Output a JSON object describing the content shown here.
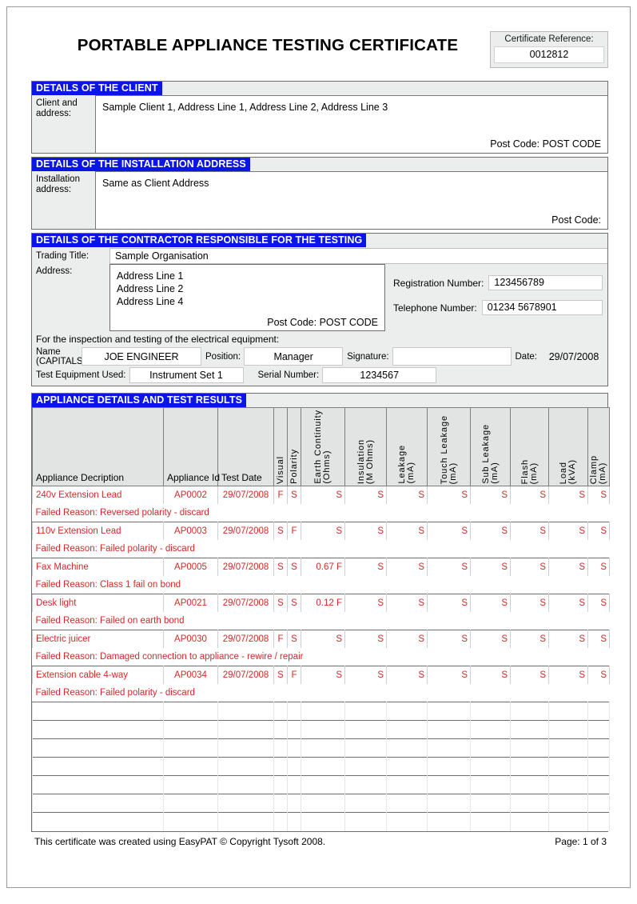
{
  "document": {
    "title": "PORTABLE APPLIANCE TESTING CERTIFICATE",
    "certificate_reference_label": "Certificate Reference:",
    "certificate_reference_value": "0012812"
  },
  "client": {
    "section_title": "DETAILS OF THE CLIENT",
    "label": "Client and address:",
    "label_line1": "Client and",
    "label_line2": "address:",
    "address": "Sample Client 1, Address Line 1, Address Line 2, Address Line 3",
    "postcode_label": "Post Code:",
    "postcode_value": "POST CODE"
  },
  "installation": {
    "section_title": "DETAILS OF THE INSTALLATION ADDRESS",
    "label_line1": "Installation",
    "label_line2": "address:",
    "address": "Same as Client Address",
    "postcode_label": "Post Code:",
    "postcode_value": ""
  },
  "contractor": {
    "section_title": "DETAILS OF THE CONTRACTOR RESPONSIBLE FOR THE TESTING",
    "trading_title_label": "Trading Title:",
    "trading_title_value": "Sample Organisation",
    "address_label": "Address:",
    "address_lines": [
      "Address Line 1",
      "Address Line 2",
      "Address Line 4"
    ],
    "postcode_label": "Post Code:",
    "postcode_value": "POST CODE",
    "registration_label": "Registration Number:",
    "registration_value": "123456789",
    "telephone_label": "Telephone Number:",
    "telephone_value": "01234 5678901",
    "for_inspection_line": "For the inspection and testing of the electrical equipment:",
    "name_label_line1": "Name",
    "name_label_line2": "(CAPITALS:",
    "name_value": "JOE ENGINEER",
    "position_label": "Position:",
    "position_value": "Manager",
    "signature_label": "Signature:",
    "signature_value": "",
    "date_label": "Date:",
    "date_value": "29/07/2008",
    "test_equipment_label": "Test Equipment Used:",
    "test_equipment_value": "Instrument Set 1",
    "serial_number_label": "Serial Number:",
    "serial_number_value": "1234567"
  },
  "appliance_table": {
    "section_title": "APPLIANCE DETAILS AND TEST RESULTS",
    "columns": [
      {
        "label": "Appliance Decription",
        "orientation": "horizontal"
      },
      {
        "label": "Appliance Id",
        "orientation": "horizontal"
      },
      {
        "label": "Test Date",
        "orientation": "horizontal"
      },
      {
        "label": "Visual",
        "orientation": "vertical"
      },
      {
        "label": "Polarity",
        "orientation": "vertical"
      },
      {
        "label": "Earth Continuity\n(Ohms)",
        "orientation": "vertical"
      },
      {
        "label": "Insulation\n(M Ohms)",
        "orientation": "vertical"
      },
      {
        "label": "Leakage\n(mA)",
        "orientation": "vertical"
      },
      {
        "label": "Touch Leakage\n(mA)",
        "orientation": "vertical"
      },
      {
        "label": "Sub Leakage\n(mA)",
        "orientation": "vertical"
      },
      {
        "label": "Flash\n(mA)",
        "orientation": "vertical"
      },
      {
        "label": "Load\n(kVA)",
        "orientation": "vertical"
      },
      {
        "label": "Clamp\n(mA)",
        "orientation": "vertical"
      }
    ],
    "header_vertical": [
      {
        "line1": "Visual",
        "line2": ""
      },
      {
        "line1": "Polarity",
        "line2": ""
      },
      {
        "line1": "Earth Continuity",
        "line2": "(Ohms)"
      },
      {
        "line1": "Insulation",
        "line2": "(M Ohms)"
      },
      {
        "line1": "Leakage",
        "line2": "(mA)"
      },
      {
        "line1": "Touch Leakage",
        "line2": "(mA)"
      },
      {
        "line1": "Sub Leakage",
        "line2": "(mA)"
      },
      {
        "line1": "Flash",
        "line2": "(mA)"
      },
      {
        "line1": "Load",
        "line2": "(kVA)"
      },
      {
        "line1": "Clamp",
        "line2": "(mA)"
      }
    ],
    "rows": [
      {
        "description": "240v Extension Lead",
        "appliance_id": "AP0002",
        "test_date": "29/07/2008",
        "visual": "F",
        "polarity": "S",
        "earth_continuity": "S",
        "insulation": "S",
        "leakage": "S",
        "touch_leakage": "S",
        "sub_leakage": "S",
        "flash": "S",
        "load": "S",
        "clamp": "S",
        "failed_reason": "Failed Reason: Reversed polarity  - discard"
      },
      {
        "description": "110v Extension Lead",
        "appliance_id": "AP0003",
        "test_date": "29/07/2008",
        "visual": "S",
        "polarity": "F",
        "earth_continuity": "S",
        "insulation": "S",
        "leakage": "S",
        "touch_leakage": "S",
        "sub_leakage": "S",
        "flash": "S",
        "load": "S",
        "clamp": "S",
        "failed_reason": "Failed Reason: Failed polarity - discard"
      },
      {
        "description": "Fax Machine",
        "appliance_id": "AP0005",
        "test_date": "29/07/2008",
        "visual": "S",
        "polarity": "S",
        "earth_continuity": "0.67 F",
        "insulation": "S",
        "leakage": "S",
        "touch_leakage": "S",
        "sub_leakage": "S",
        "flash": "S",
        "load": "S",
        "clamp": "S",
        "failed_reason": "Failed Reason: Class 1 fail on bond"
      },
      {
        "description": "Desk light",
        "appliance_id": "AP0021",
        "test_date": "29/07/2008",
        "visual": "S",
        "polarity": "S",
        "earth_continuity": "0.12 F",
        "insulation": "S",
        "leakage": "S",
        "touch_leakage": "S",
        "sub_leakage": "S",
        "flash": "S",
        "load": "S",
        "clamp": "S",
        "failed_reason": "Failed Reason: Failed on earth bond"
      },
      {
        "description": "Electric juicer",
        "appliance_id": "AP0030",
        "test_date": "29/07/2008",
        "visual": "F",
        "polarity": "S",
        "earth_continuity": "S",
        "insulation": "S",
        "leakage": "S",
        "touch_leakage": "S",
        "sub_leakage": "S",
        "flash": "S",
        "load": "S",
        "clamp": "S",
        "failed_reason": "Failed Reason: Damaged connection to appliance - rewire / repair"
      },
      {
        "description": "Extension cable 4-way",
        "appliance_id": "AP0034",
        "test_date": "29/07/2008",
        "visual": "S",
        "polarity": "F",
        "earth_continuity": "S",
        "insulation": "S",
        "leakage": "S",
        "touch_leakage": "S",
        "sub_leakage": "S",
        "flash": "S",
        "load": "S",
        "clamp": "S",
        "failed_reason": "Failed Reason: Failed polarity - discard"
      }
    ],
    "blank_row_count": 7
  },
  "footer": {
    "left": "This certificate was created using EasyPAT © Copyright Tysoft 2008.",
    "right": "Page: 1 of 3"
  },
  "colors": {
    "section_bar": "#0b15e8",
    "fail_text": "#d02b2b",
    "panel_grey": "#eceded"
  }
}
